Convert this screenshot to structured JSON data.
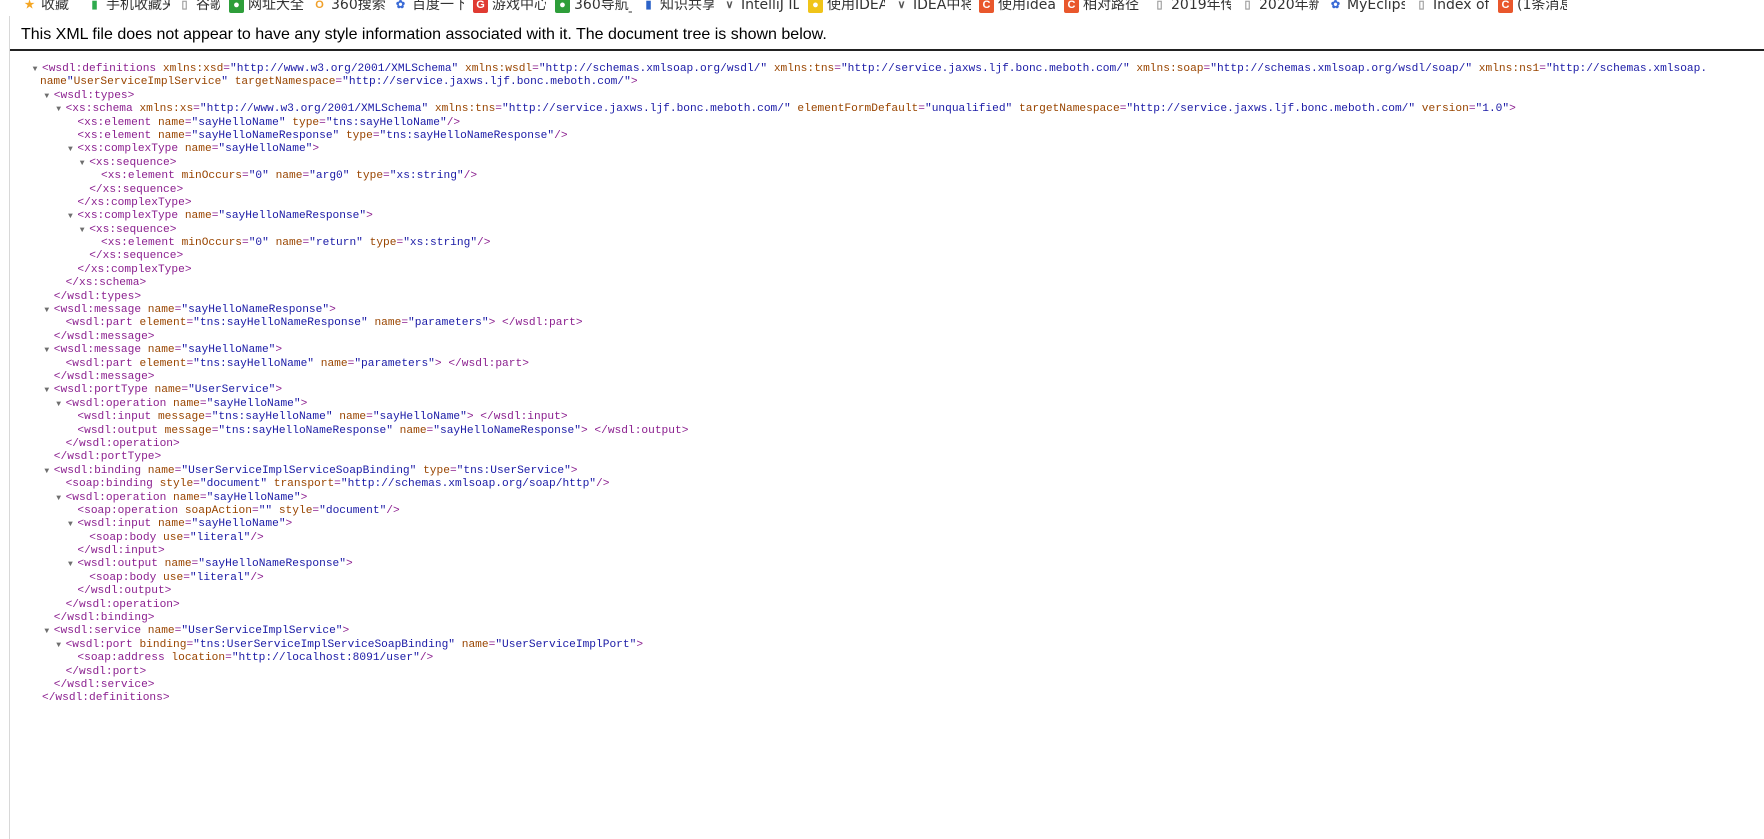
{
  "browser": {
    "bookmarks": [
      {
        "label": "收藏",
        "icon": "star-icon",
        "color": "#f5a623",
        "glyph": "★"
      },
      {
        "label": "手机收藏夹",
        "icon": "phone-icon",
        "color": "#2eaa4d",
        "glyph": "▮"
      },
      {
        "label": "谷歌",
        "icon": "page-icon",
        "color": "#9a9a9a",
        "glyph": "▯"
      },
      {
        "label": "网址大全",
        "icon": "web-directory-icon",
        "color": "#2e9e3a",
        "glyph": "●"
      },
      {
        "label": "360搜索",
        "icon": "search-360-icon",
        "color": "#f0a02a",
        "glyph": "O"
      },
      {
        "label": "百度一下",
        "icon": "baidu-paw-icon",
        "color": "#3b6bd6",
        "glyph": "✿"
      },
      {
        "label": "游戏中心",
        "icon": "game-center-icon",
        "color": "#e03b32",
        "glyph": "G"
      },
      {
        "label": "360导航_",
        "icon": "nav-360-icon",
        "color": "#2e9e3a",
        "glyph": "●"
      },
      {
        "label": "知识共享",
        "icon": "bookmark-blue-icon",
        "color": "#2b62c8",
        "glyph": "▮"
      },
      {
        "label": "IntelliJ ID",
        "icon": "intellij-icon",
        "color": "#555555",
        "glyph": "∨"
      },
      {
        "label": "使用IDEA",
        "icon": "bulb-icon",
        "color": "#f0c419",
        "glyph": "●"
      },
      {
        "label": "IDEA中将",
        "icon": "intellij-icon",
        "color": "#555555",
        "glyph": "∨"
      },
      {
        "label": "使用idea",
        "icon": "csdn-icon",
        "color": "#e9572c",
        "glyph": "C"
      },
      {
        "label": "相对路径",
        "icon": "csdn-icon",
        "color": "#e9572c",
        "glyph": "C"
      },
      {
        "label": "2019年传",
        "icon": "page-icon",
        "color": "#9a9a9a",
        "glyph": "▯"
      },
      {
        "label": "2020年新",
        "icon": "page-icon",
        "color": "#9a9a9a",
        "glyph": "▯"
      },
      {
        "label": "MyEclips",
        "icon": "baidu-paw-icon",
        "color": "#3b6bd6",
        "glyph": "✿"
      },
      {
        "label": "Index of",
        "icon": "page-icon",
        "color": "#9a9a9a",
        "glyph": "▯"
      },
      {
        "label": "(1条消息",
        "icon": "csdn-icon",
        "color": "#e9572c",
        "glyph": "C"
      }
    ]
  },
  "viewer": {
    "info_message": "This XML file does not appear to have any style information associated with it. The document tree is shown below."
  },
  "xml_lines": [
    "<wsdl:definitions xmlns:xsd=\"http://www.w3.org/2001/XMLSchema\" xmlns:wsdl=\"http://schemas.xmlsoap.org/wsdl/\" xmlns:tns=\"http://service.jaxws.ljf.bonc.meboth.com/\" xmlns:soap=\"http://schemas.xmlsoap.org/wsdl/soap/\" xmlns:ns1=\"http://schemas.xmlsoap.",
    "name=\"UserServiceImplService\" targetNamespace=\"http://service.jaxws.ljf.bonc.meboth.com/\">",
    "<wsdl:types>",
    "<xs:schema xmlns:xs=\"http://www.w3.org/2001/XMLSchema\" xmlns:tns=\"http://service.jaxws.ljf.bonc.meboth.com/\" elementFormDefault=\"unqualified\" targetNamespace=\"http://service.jaxws.ljf.bonc.meboth.com/\" version=\"1.0\">",
    "<xs:element name=\"sayHelloName\" type=\"tns:sayHelloName\"/>",
    "<xs:element name=\"sayHelloNameResponse\" type=\"tns:sayHelloNameResponse\"/>",
    "<xs:complexType name=\"sayHelloName\">",
    "<xs:sequence>",
    "<xs:element minOccurs=\"0\" name=\"arg0\" type=\"xs:string\"/>",
    "</xs:sequence>",
    "</xs:complexType>",
    "<xs:complexType name=\"sayHelloNameResponse\">",
    "<xs:sequence>",
    "<xs:element minOccurs=\"0\" name=\"return\" type=\"xs:string\"/>",
    "</xs:sequence>",
    "</xs:complexType>",
    "</xs:schema>",
    "</wsdl:types>",
    "<wsdl:message name=\"sayHelloNameResponse\">",
    "<wsdl:part element=\"tns:sayHelloNameResponse\" name=\"parameters\"> </wsdl:part>",
    "</wsdl:message>",
    "<wsdl:message name=\"sayHelloName\">",
    "<wsdl:part element=\"tns:sayHelloName\" name=\"parameters\"> </wsdl:part>",
    "</wsdl:message>",
    "<wsdl:portType name=\"UserService\">",
    "<wsdl:operation name=\"sayHelloName\">",
    "<wsdl:input message=\"tns:sayHelloName\" name=\"sayHelloName\"> </wsdl:input>",
    "<wsdl:output message=\"tns:sayHelloNameResponse\" name=\"sayHelloNameResponse\"> </wsdl:output>",
    "</wsdl:operation>",
    "</wsdl:portType>",
    "<wsdl:binding name=\"UserServiceImplServiceSoapBinding\" type=\"tns:UserService\">",
    "<soap:binding style=\"document\" transport=\"http://schemas.xmlsoap.org/soap/http\"/>",
    "<wsdl:operation name=\"sayHelloName\">",
    "<soap:operation soapAction=\"\" style=\"document\"/>",
    "<wsdl:input name=\"sayHelloName\">",
    "<soap:body use=\"literal\"/>",
    "</wsdl:input>",
    "<wsdl:output name=\"sayHelloNameResponse\">",
    "<soap:body use=\"literal\"/>",
    "</wsdl:output>",
    "</wsdl:operation>",
    "</wsdl:binding>",
    "<wsdl:service name=\"UserServiceImplService\">",
    "<wsdl:port binding=\"tns:UserServiceImplServiceSoapBinding\" name=\"UserServiceImplPort\">",
    "<soap:address location=\"http://localhost:8091/user\"/>",
    "</wsdl:port>",
    "</wsdl:service>",
    "</wsdl:definitions>"
  ]
}
